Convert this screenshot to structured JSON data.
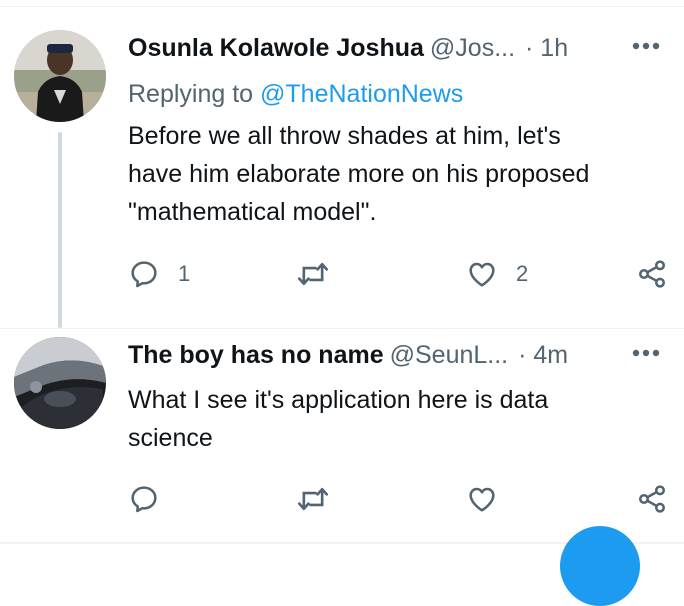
{
  "tweets": [
    {
      "name": "Osunla Kolawole Joshua",
      "handle": "@Jos...",
      "time": "· 1h",
      "replying_prefix": "Replying to ",
      "replying_to": "@TheNationNews",
      "text": "Before we all throw shades at him, let's\nhave him elaborate more on his proposed\n\"mathematical model\".",
      "reply_count": "1",
      "retweet_count": "",
      "like_count": "2",
      "avatar_icon": "person-photo-avatar"
    },
    {
      "name": "The boy has no name",
      "handle": "@SeunL...",
      "time": "· 4m",
      "text": "What I see it's application here is data\nscience",
      "reply_count": "",
      "retweet_count": "",
      "like_count": "",
      "avatar_icon": "car-interior-avatar"
    }
  ],
  "icons": {
    "more": "more-dots-icon",
    "reply": "reply-bubble-icon",
    "retweet": "retweet-arrows-icon",
    "like": "heart-icon",
    "share": "share-icon"
  },
  "colors": {
    "accent": "#1d9bf0",
    "secondary_text": "#536471",
    "primary_text": "#0f1419",
    "thread_line": "#cfd9de"
  }
}
